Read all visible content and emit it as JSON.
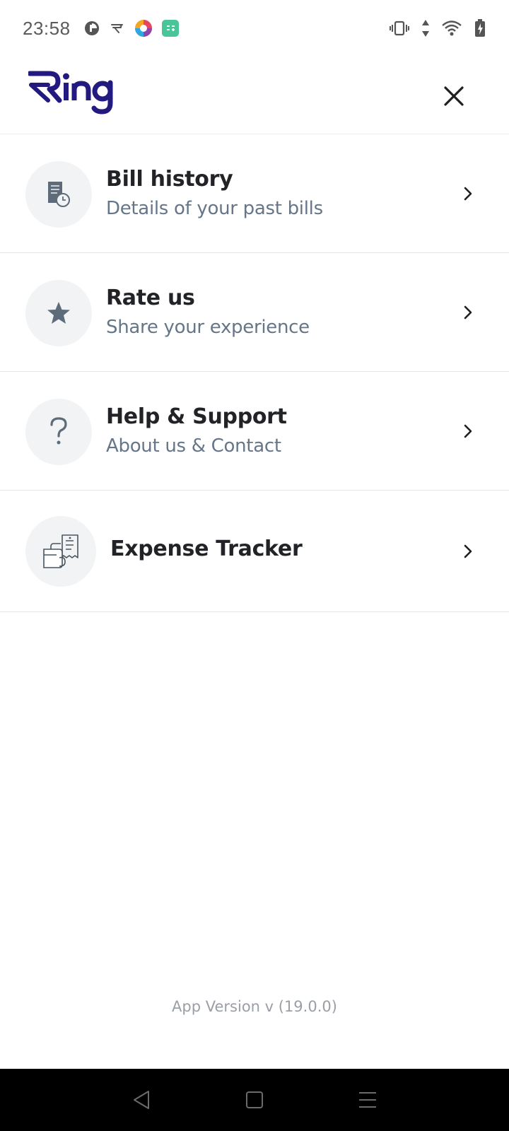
{
  "status_bar": {
    "time": "23:58",
    "left_icons": [
      "pie-chart-icon",
      "ring-rupee-icon",
      "colorful-app-icon",
      "calculator-app-icon"
    ],
    "right_icons": [
      "vibrate-icon",
      "data-arrows-icon",
      "wifi-icon",
      "battery-charging-icon"
    ]
  },
  "header": {
    "logo_text": "Ring",
    "brand_color": "#231a80",
    "close_icon": "close-icon"
  },
  "menu": {
    "items": [
      {
        "title": "Bill history",
        "subtitle": "Details of your past bills",
        "icon": "bill-history-icon"
      },
      {
        "title": "Rate us",
        "subtitle": "Share your experience",
        "icon": "star-icon"
      },
      {
        "title": "Help & Support",
        "subtitle": "About us & Contact",
        "icon": "question-icon"
      },
      {
        "title": "Expense Tracker",
        "subtitle": "",
        "icon": "expense-tracker-icon"
      }
    ]
  },
  "footer": {
    "app_version": "App Version v (19.0.0)"
  },
  "nav_bar": {
    "buttons": [
      "back-icon",
      "home-icon",
      "recents-icon"
    ]
  }
}
